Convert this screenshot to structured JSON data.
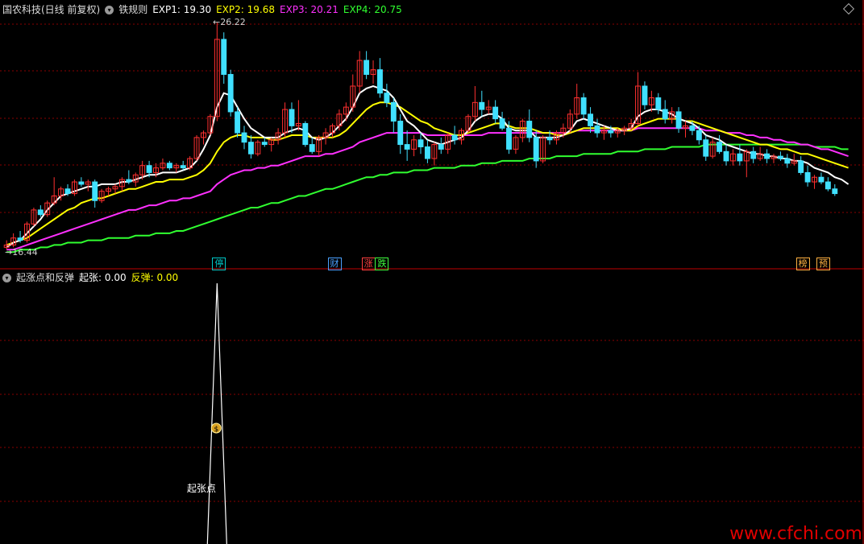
{
  "main_header": {
    "stock_name": "国农科技(日线 前复权)",
    "indicator_name": "铁规则",
    "exp1": "EXP1: 19.30",
    "exp2": "EXP2: 19.68",
    "exp3": "EXP3: 20.21",
    "exp4": "EXP4: 20.75"
  },
  "sub_header": {
    "indicator_name": "起涨点和反弹",
    "qizhang": "起张: 0.00",
    "fantan": "反弹: 0.00"
  },
  "price_labels": {
    "high": "26.22",
    "low": "16.44"
  },
  "badges": [
    {
      "text": "停",
      "color": "#00c8c8"
    },
    {
      "text": "财",
      "color": "#4aa0ff"
    },
    {
      "text": "涨",
      "color": "#ff4040"
    },
    {
      "text": "跌",
      "color": "#40ff40"
    },
    {
      "text": "榜",
      "color": "#ffb040"
    },
    {
      "text": "预",
      "color": "#ffb040"
    }
  ],
  "signal": {
    "icon": "$",
    "label": "起张点"
  },
  "watermark": "www.cfchi.com",
  "colors": {
    "up": "#ff3030",
    "down": "#40e0ff",
    "exp1": "#ffffff",
    "exp2": "#ffff00",
    "exp3": "#ff30ff",
    "exp4": "#30ff30",
    "grid": "#8a0000"
  },
  "chart_data": {
    "type": "candlestick",
    "price_range": [
      16.44,
      26.22
    ],
    "candles": [
      [
        16.6,
        16.9,
        16.5,
        16.7
      ],
      [
        16.7,
        17.2,
        16.6,
        17.0
      ],
      [
        17.0,
        17.3,
        16.8,
        16.9
      ],
      [
        16.9,
        17.7,
        16.8,
        17.6
      ],
      [
        17.6,
        18.3,
        17.5,
        18.2
      ],
      [
        18.2,
        18.4,
        17.9,
        18.0
      ],
      [
        18.0,
        18.6,
        17.9,
        18.5
      ],
      [
        18.5,
        19.6,
        18.4,
        18.8
      ],
      [
        18.8,
        19.2,
        18.6,
        19.1
      ],
      [
        19.1,
        19.3,
        18.8,
        18.9
      ],
      [
        18.9,
        19.5,
        18.8,
        19.4
      ],
      [
        19.4,
        19.6,
        19.2,
        19.3
      ],
      [
        19.3,
        19.5,
        19.0,
        19.4
      ],
      [
        19.4,
        19.5,
        18.3,
        18.6
      ],
      [
        18.6,
        19.1,
        18.5,
        19.0
      ],
      [
        19.0,
        19.2,
        18.8,
        19.1
      ],
      [
        19.1,
        19.3,
        18.9,
        19.2
      ],
      [
        19.2,
        19.6,
        19.0,
        19.5
      ],
      [
        19.5,
        19.9,
        19.3,
        19.4
      ],
      [
        19.4,
        19.8,
        19.2,
        19.7
      ],
      [
        19.7,
        20.3,
        19.5,
        20.1
      ],
      [
        20.1,
        20.3,
        19.6,
        19.8
      ],
      [
        19.8,
        20.2,
        19.6,
        20.0
      ],
      [
        20.0,
        20.4,
        19.9,
        20.2
      ],
      [
        20.2,
        20.3,
        19.9,
        20.0
      ],
      [
        20.0,
        20.2,
        19.8,
        20.1
      ],
      [
        20.1,
        20.3,
        19.9,
        20.0
      ],
      [
        20.0,
        20.5,
        19.9,
        20.4
      ],
      [
        20.4,
        21.4,
        20.3,
        21.3
      ],
      [
        21.3,
        21.6,
        21.0,
        21.5
      ],
      [
        21.5,
        22.3,
        21.4,
        22.2
      ],
      [
        22.2,
        26.22,
        22.0,
        25.5
      ],
      [
        25.5,
        25.8,
        23.6,
        24.0
      ],
      [
        24.0,
        24.2,
        22.2,
        22.4
      ],
      [
        22.4,
        22.6,
        21.3,
        21.5
      ],
      [
        21.5,
        21.8,
        20.8,
        21.1
      ],
      [
        21.1,
        21.4,
        20.4,
        20.6
      ],
      [
        20.6,
        21.2,
        20.5,
        21.1
      ],
      [
        21.1,
        21.3,
        20.9,
        21.0
      ],
      [
        21.0,
        21.3,
        20.7,
        21.2
      ],
      [
        21.2,
        21.7,
        21.0,
        21.5
      ],
      [
        21.5,
        22.8,
        21.3,
        22.5
      ],
      [
        22.5,
        22.8,
        21.5,
        21.8
      ],
      [
        21.8,
        22.9,
        21.6,
        21.9
      ],
      [
        21.9,
        22.0,
        20.9,
        21.0
      ],
      [
        21.0,
        21.3,
        20.6,
        20.7
      ],
      [
        20.7,
        21.4,
        20.5,
        21.3
      ],
      [
        21.3,
        21.7,
        21.0,
        21.5
      ],
      [
        21.5,
        21.9,
        21.3,
        21.8
      ],
      [
        21.8,
        22.5,
        21.6,
        22.3
      ],
      [
        22.3,
        22.8,
        22.0,
        22.6
      ],
      [
        22.6,
        24.0,
        22.4,
        23.5
      ],
      [
        23.5,
        25.0,
        23.2,
        24.6
      ],
      [
        24.6,
        25.0,
        23.8,
        24.0
      ],
      [
        24.0,
        24.6,
        23.6,
        24.2
      ],
      [
        24.2,
        24.7,
        23.0,
        23.2
      ],
      [
        23.2,
        23.6,
        22.6,
        22.8
      ],
      [
        22.8,
        23.0,
        21.5,
        22.0
      ],
      [
        22.0,
        22.3,
        20.6,
        21.0
      ],
      [
        21.0,
        21.6,
        20.3,
        20.8
      ],
      [
        20.8,
        21.4,
        20.5,
        21.2
      ],
      [
        21.2,
        21.5,
        20.6,
        20.9
      ],
      [
        20.9,
        21.2,
        20.2,
        20.4
      ],
      [
        20.4,
        21.1,
        20.1,
        21.0
      ],
      [
        21.0,
        21.3,
        20.6,
        20.8
      ],
      [
        20.8,
        21.5,
        20.6,
        21.4
      ],
      [
        21.4,
        21.8,
        21.0,
        21.2
      ],
      [
        21.2,
        21.7,
        21.0,
        21.6
      ],
      [
        21.6,
        22.3,
        21.5,
        22.2
      ],
      [
        22.2,
        23.5,
        22.0,
        22.8
      ],
      [
        22.8,
        23.3,
        22.2,
        22.5
      ],
      [
        22.5,
        22.9,
        22.3,
        22.6
      ],
      [
        22.6,
        22.9,
        21.9,
        22.1
      ],
      [
        22.1,
        22.4,
        21.6,
        21.7
      ],
      [
        21.7,
        22.0,
        20.6,
        20.8
      ],
      [
        20.8,
        21.4,
        20.6,
        21.3
      ],
      [
        21.3,
        22.1,
        21.1,
        22.0
      ],
      [
        22.0,
        22.5,
        21.1,
        21.3
      ],
      [
        21.3,
        21.6,
        20.0,
        20.3
      ],
      [
        20.3,
        21.4,
        20.2,
        21.3
      ],
      [
        21.3,
        21.6,
        21.0,
        21.2
      ],
      [
        21.2,
        21.6,
        21.0,
        21.5
      ],
      [
        21.5,
        21.9,
        21.3,
        21.7
      ],
      [
        21.7,
        22.5,
        21.5,
        22.3
      ],
      [
        22.3,
        23.6,
        22.1,
        23.0
      ],
      [
        23.0,
        23.2,
        22.1,
        22.3
      ],
      [
        22.3,
        22.6,
        21.5,
        21.8
      ],
      [
        21.8,
        22.1,
        21.3,
        21.5
      ],
      [
        21.5,
        21.8,
        21.2,
        21.6
      ],
      [
        21.6,
        21.8,
        21.3,
        21.5
      ],
      [
        21.5,
        21.7,
        21.3,
        21.6
      ],
      [
        21.6,
        21.8,
        21.4,
        21.7
      ],
      [
        21.7,
        22.1,
        21.6,
        21.9
      ],
      [
        21.9,
        24.1,
        21.8,
        23.5
      ],
      [
        23.5,
        23.7,
        22.5,
        22.7
      ],
      [
        22.7,
        23.3,
        22.4,
        23.0
      ],
      [
        23.0,
        23.2,
        22.3,
        22.5
      ],
      [
        22.5,
        22.9,
        21.9,
        22.1
      ],
      [
        22.1,
        22.6,
        21.9,
        22.4
      ],
      [
        22.4,
        22.6,
        21.5,
        21.7
      ],
      [
        21.7,
        22.0,
        21.3,
        21.8
      ],
      [
        21.8,
        22.0,
        21.4,
        21.6
      ],
      [
        21.6,
        21.8,
        21.0,
        21.2
      ],
      [
        21.2,
        21.4,
        20.3,
        20.5
      ],
      [
        20.5,
        21.3,
        20.4,
        21.1
      ],
      [
        21.1,
        21.4,
        20.6,
        20.7
      ],
      [
        20.7,
        21.0,
        20.1,
        20.3
      ],
      [
        20.3,
        20.8,
        20.1,
        20.6
      ],
      [
        20.6,
        21.0,
        20.1,
        20.3
      ],
      [
        20.3,
        20.8,
        19.6,
        20.7
      ],
      [
        20.7,
        20.9,
        20.2,
        20.4
      ],
      [
        20.4,
        20.9,
        20.3,
        20.6
      ],
      [
        20.6,
        20.8,
        20.2,
        20.4
      ],
      [
        20.4,
        20.6,
        20.2,
        20.5
      ],
      [
        20.5,
        20.7,
        20.3,
        20.4
      ],
      [
        20.4,
        20.6,
        20.0,
        20.2
      ],
      [
        20.2,
        20.6,
        20.1,
        20.3
      ],
      [
        20.3,
        20.5,
        19.7,
        19.8
      ],
      [
        19.8,
        20.1,
        19.2,
        19.4
      ],
      [
        19.4,
        19.7,
        19.1,
        19.6
      ],
      [
        19.6,
        19.8,
        19.3,
        19.4
      ],
      [
        19.4,
        19.6,
        19.0,
        19.1
      ],
      [
        19.1,
        19.3,
        18.8,
        18.9
      ]
    ],
    "exp1": [
      16.6,
      16.8,
      16.9,
      17.2,
      17.5,
      17.8,
      18.2,
      18.5,
      18.8,
      18.9,
      19.0,
      19.1,
      19.2,
      19.2,
      19.3,
      19.3,
      19.3,
      19.4,
      19.4,
      19.5,
      19.6,
      19.7,
      19.7,
      19.8,
      19.8,
      19.8,
      19.9,
      20.0,
      20.3,
      20.8,
      21.4,
      22.6,
      23.2,
      23.1,
      22.6,
      22.1,
      21.7,
      21.5,
      21.3,
      21.3,
      21.3,
      21.5,
      21.6,
      21.7,
      21.6,
      21.3,
      21.2,
      21.3,
      21.5,
      21.8,
      22.1,
      22.6,
      23.2,
      23.4,
      23.5,
      23.4,
      23.3,
      23.0,
      22.5,
      22.0,
      21.8,
      21.5,
      21.2,
      21.1,
      21.0,
      21.1,
      21.2,
      21.3,
      21.6,
      22.0,
      22.2,
      22.3,
      22.3,
      22.1,
      21.7,
      21.6,
      21.6,
      21.6,
      21.3,
      21.3,
      21.3,
      21.3,
      21.4,
      21.6,
      22.0,
      22.1,
      22.0,
      21.9,
      21.8,
      21.7,
      21.6,
      21.6,
      21.7,
      22.2,
      22.4,
      22.5,
      22.5,
      22.4,
      22.3,
      22.1,
      22.0,
      21.9,
      21.7,
      21.4,
      21.3,
      21.2,
      21.0,
      20.9,
      20.8,
      20.7,
      20.6,
      20.6,
      20.5,
      20.5,
      20.4,
      20.4,
      20.3,
      20.3,
      20.2,
      20.0,
      19.9,
      19.8,
      19.6,
      19.5,
      19.3
    ],
    "exp2": [
      16.7,
      16.8,
      16.9,
      17.0,
      17.2,
      17.4,
      17.6,
      17.8,
      18.0,
      18.2,
      18.3,
      18.5,
      18.6,
      18.7,
      18.7,
      18.8,
      18.9,
      19.0,
      19.1,
      19.1,
      19.2,
      19.3,
      19.4,
      19.4,
      19.5,
      19.5,
      19.5,
      19.6,
      19.7,
      19.9,
      20.2,
      20.7,
      21.1,
      21.3,
      21.4,
      21.4,
      21.3,
      21.3,
      21.3,
      21.2,
      21.2,
      21.3,
      21.4,
      21.4,
      21.4,
      21.3,
      21.3,
      21.3,
      21.3,
      21.4,
      21.6,
      21.9,
      22.2,
      22.5,
      22.7,
      22.8,
      22.8,
      22.7,
      22.6,
      22.4,
      22.2,
      22.0,
      21.9,
      21.7,
      21.6,
      21.5,
      21.4,
      21.4,
      21.5,
      21.6,
      21.7,
      21.8,
      21.9,
      21.9,
      21.8,
      21.7,
      21.7,
      21.7,
      21.6,
      21.5,
      21.5,
      21.4,
      21.4,
      21.5,
      21.6,
      21.7,
      21.7,
      21.7,
      21.7,
      21.7,
      21.7,
      21.6,
      21.6,
      21.8,
      21.9,
      22.0,
      22.1,
      22.1,
      22.1,
      22.1,
      22.0,
      22.0,
      21.9,
      21.8,
      21.7,
      21.6,
      21.5,
      21.4,
      21.3,
      21.2,
      21.1,
      21.0,
      21.0,
      20.9,
      20.8,
      20.8,
      20.7,
      20.6,
      20.6,
      20.5,
      20.4,
      20.3,
      20.2,
      20.1,
      20.0
    ],
    "exp3": [
      16.5,
      16.5,
      16.6,
      16.7,
      16.8,
      16.9,
      17.0,
      17.1,
      17.2,
      17.3,
      17.4,
      17.5,
      17.6,
      17.7,
      17.8,
      17.9,
      18.0,
      18.1,
      18.2,
      18.2,
      18.3,
      18.4,
      18.4,
      18.5,
      18.6,
      18.6,
      18.7,
      18.7,
      18.8,
      18.9,
      19.0,
      19.3,
      19.5,
      19.7,
      19.8,
      19.9,
      19.9,
      20.0,
      20.0,
      20.1,
      20.1,
      20.2,
      20.3,
      20.4,
      20.5,
      20.5,
      20.5,
      20.6,
      20.6,
      20.7,
      20.8,
      20.9,
      21.1,
      21.2,
      21.3,
      21.4,
      21.5,
      21.5,
      21.5,
      21.5,
      21.5,
      21.5,
      21.4,
      21.4,
      21.4,
      21.4,
      21.4,
      21.4,
      21.4,
      21.4,
      21.4,
      21.5,
      21.5,
      21.5,
      21.5,
      21.5,
      21.5,
      21.5,
      21.5,
      21.5,
      21.5,
      21.5,
      21.5,
      21.5,
      21.6,
      21.6,
      21.6,
      21.6,
      21.6,
      21.6,
      21.6,
      21.6,
      21.6,
      21.7,
      21.7,
      21.7,
      21.7,
      21.7,
      21.7,
      21.7,
      21.7,
      21.7,
      21.7,
      21.6,
      21.6,
      21.6,
      21.5,
      21.5,
      21.5,
      21.4,
      21.4,
      21.3,
      21.3,
      21.2,
      21.2,
      21.1,
      21.1,
      21.0,
      21.0,
      20.9,
      20.8,
      20.8,
      20.7,
      20.6,
      20.5
    ],
    "exp4": [
      16.4,
      16.4,
      16.5,
      16.5,
      16.5,
      16.6,
      16.6,
      16.7,
      16.7,
      16.8,
      16.8,
      16.8,
      16.9,
      16.9,
      16.9,
      17.0,
      17.0,
      17.0,
      17.0,
      17.1,
      17.1,
      17.1,
      17.2,
      17.2,
      17.2,
      17.3,
      17.3,
      17.4,
      17.5,
      17.6,
      17.7,
      17.8,
      17.9,
      18.0,
      18.1,
      18.2,
      18.3,
      18.3,
      18.4,
      18.5,
      18.5,
      18.6,
      18.7,
      18.8,
      18.8,
      18.9,
      19.0,
      19.1,
      19.1,
      19.2,
      19.3,
      19.4,
      19.5,
      19.6,
      19.6,
      19.7,
      19.7,
      19.8,
      19.8,
      19.8,
      19.9,
      19.9,
      19.9,
      20.0,
      20.0,
      20.0,
      20.0,
      20.1,
      20.1,
      20.1,
      20.2,
      20.2,
      20.2,
      20.3,
      20.3,
      20.3,
      20.3,
      20.4,
      20.4,
      20.4,
      20.4,
      20.5,
      20.5,
      20.5,
      20.5,
      20.6,
      20.6,
      20.6,
      20.6,
      20.6,
      20.7,
      20.7,
      20.7,
      20.7,
      20.8,
      20.8,
      20.8,
      20.8,
      20.9,
      20.9,
      20.9,
      20.9,
      20.9,
      21.0,
      21.0,
      21.0,
      21.0,
      21.0,
      21.0,
      21.0,
      21.0,
      21.0,
      21.0,
      21.0,
      21.0,
      21.0,
      21.0,
      21.0,
      21.0,
      20.9,
      20.9,
      20.9,
      20.9,
      20.8,
      20.8
    ],
    "signal_peak_index": 31,
    "badge_candle_index": [
      31,
      48,
      53,
      55,
      117,
      120
    ]
  }
}
